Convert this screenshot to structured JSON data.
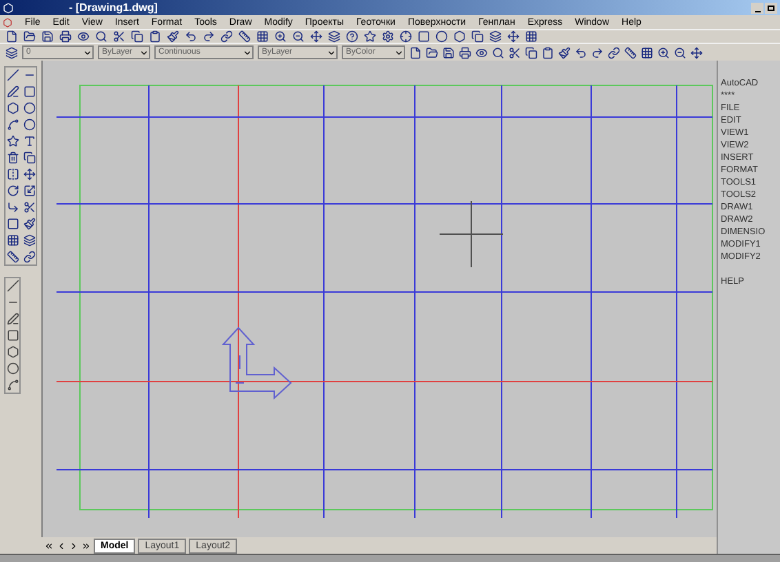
{
  "window": {
    "title": "- [Drawing1.dwg]"
  },
  "menu": [
    "File",
    "Edit",
    "View",
    "Insert",
    "Format",
    "Tools",
    "Draw",
    "Modify",
    "Проекты",
    "Геоточки",
    "Поверхности",
    "Генплан",
    "Express",
    "Window",
    "Help"
  ],
  "properties_toolbar": {
    "layer": "0",
    "color_control": "ByLayer",
    "linetype": "Continuous",
    "lineweight": "ByLayer",
    "plot_style": "ByColor"
  },
  "screen_menu": [
    "AutoCAD",
    "****",
    "FILE",
    "EDIT",
    "VIEW1",
    "VIEW2",
    "INSERT",
    "FORMAT",
    "TOOLS1",
    "TOOLS2",
    "DRAW1",
    "DRAW2",
    "DIMENSIO",
    "MODIFY1",
    "MODIFY2"
  ],
  "screen_menu_help": "HELP",
  "layout_tabs": [
    {
      "label": "Model",
      "selected": true
    },
    {
      "label": "Layout1",
      "selected": false
    },
    {
      "label": "Layout2",
      "selected": false
    }
  ]
}
